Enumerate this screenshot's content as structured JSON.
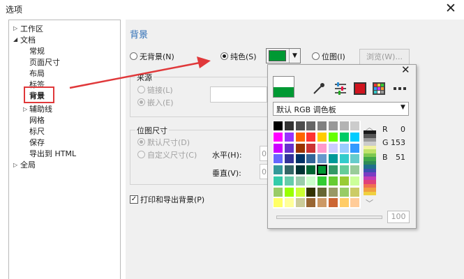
{
  "window": {
    "title": "选项",
    "close_glyph": "✕"
  },
  "tree": {
    "items": [
      {
        "label": "工作区",
        "level": 0,
        "twisty": "▷"
      },
      {
        "label": "文档",
        "level": 0,
        "twisty": "◢"
      },
      {
        "label": "常规",
        "level": 1
      },
      {
        "label": "页面尺寸",
        "level": 1
      },
      {
        "label": "布局",
        "level": 1
      },
      {
        "label": "标签",
        "level": 1
      },
      {
        "label": "背景",
        "level": 1,
        "selected": true
      },
      {
        "label": "辅助线",
        "level": 1,
        "twisty": "▷"
      },
      {
        "label": "网格",
        "level": 1
      },
      {
        "label": "标尺",
        "level": 1
      },
      {
        "label": "保存",
        "level": 1
      },
      {
        "label": "导出到 HTML",
        "level": 1
      },
      {
        "label": "全局",
        "level": 0,
        "twisty": "▷"
      }
    ]
  },
  "background": {
    "heading": "背景",
    "no_bg_label": "无背景(N)",
    "solid_label": "纯色(S)",
    "solid_color": "#009933",
    "dropdown_glyph": "▼",
    "bitmap_label": "位图(I)",
    "browse_label": "浏览(W)...",
    "source_group": "来源",
    "link_label": "链接(L)",
    "embed_label": "嵌入(E)",
    "bitmap_size_group": "位图尺寸",
    "default_size_label": "默认尺寸(D)",
    "custom_size_label": "自定义尺寸(C)",
    "horizontal_label": "水平(H):",
    "vertical_label": "垂直(V):",
    "h_value_partial": "0",
    "v_value_partial": "0",
    "print_export_label": "打印和导出背景(P)",
    "print_export_checked": true,
    "check_glyph": "✓"
  },
  "color_popup": {
    "close_glyph": "✕",
    "current_color": "#009933",
    "tools": [
      "eyedropper-icon",
      "color-sliders-icon",
      "color-viewer-icon",
      "color-palettes-icon",
      "more-icon"
    ],
    "palette_name": "默认 RGB 调色板",
    "dropdown_glyph": "▼",
    "rgb": {
      "r_label": "R",
      "g_label": "G",
      "b_label": "B",
      "r": "0",
      "g": "153",
      "b": "51"
    },
    "zoom_value": "100",
    "swatches": [
      [
        "#000000",
        "#333333",
        "#4d4d4d",
        "#666666",
        "#808080",
        "#999999",
        "#b3b3b3",
        "#cccccc"
      ],
      [
        "#ff00ff",
        "#9933ff",
        "#ff6600",
        "#ff3333",
        "#ffcc00",
        "#66ff00",
        "#00cc66",
        "#00ccff"
      ],
      [
        "#cc00ff",
        "#6633cc",
        "#993300",
        "#cc3333",
        "#ff99cc",
        "#ccccff",
        "#99ccff",
        "#3399ff"
      ],
      [
        "#6666ff",
        "#333399",
        "#003366",
        "#336699",
        "#6699cc",
        "#009999",
        "#33cccc",
        "#66cccc"
      ],
      [
        "#339999",
        "#336666",
        "#003333",
        "#006633",
        "#009933",
        "#339966",
        "#66cc99",
        "#99cc99"
      ],
      [
        "#33ccaa",
        "#66ccaa",
        "#99ccaa",
        "#ccffcc",
        "#33cc33",
        "#66cc33",
        "#99cc33",
        "#ccff99"
      ],
      [
        "#99cc66",
        "#99ff00",
        "#ccff33",
        "#333300",
        "#666633",
        "#999966",
        "#99cc66",
        "#cccc66"
      ],
      [
        "#ffff66",
        "#ffff99",
        "#cccc99",
        "#996633",
        "#cc9966",
        "#cc6633",
        "#ffcc66",
        "#ffcc99"
      ]
    ],
    "selected_swatch": [
      4,
      4
    ],
    "strip_colors": [
      "#1a1a1a",
      "#555555",
      "#999999",
      "#cccccc",
      "#f2f2a0",
      "#bfe36b",
      "#7ec850",
      "#41a74a",
      "#2e8b57",
      "#1f6f8b",
      "#3a4fb0",
      "#7a3cc2",
      "#c23cb4",
      "#e0407a",
      "#f07050",
      "#f0a040",
      "#f0d040"
    ]
  }
}
